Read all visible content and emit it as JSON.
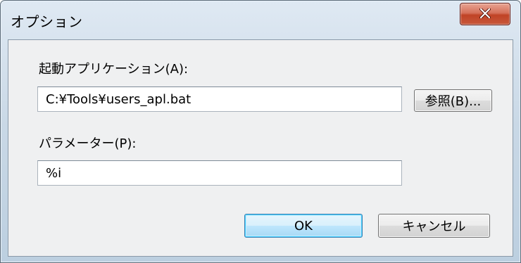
{
  "window": {
    "title": "オプション",
    "close_icon": "close-icon"
  },
  "form": {
    "app_label": "起動アプリケーション(A):",
    "app_value": "C:¥Tools¥users_apl.bat",
    "browse_label": "参照(B)...",
    "param_label": "パラメーター(P):",
    "param_value": "%i"
  },
  "buttons": {
    "ok": "OK",
    "cancel": "キャンセル"
  },
  "colors": {
    "close_button": "#c7583b",
    "default_button_border": "#3c7fb1"
  }
}
